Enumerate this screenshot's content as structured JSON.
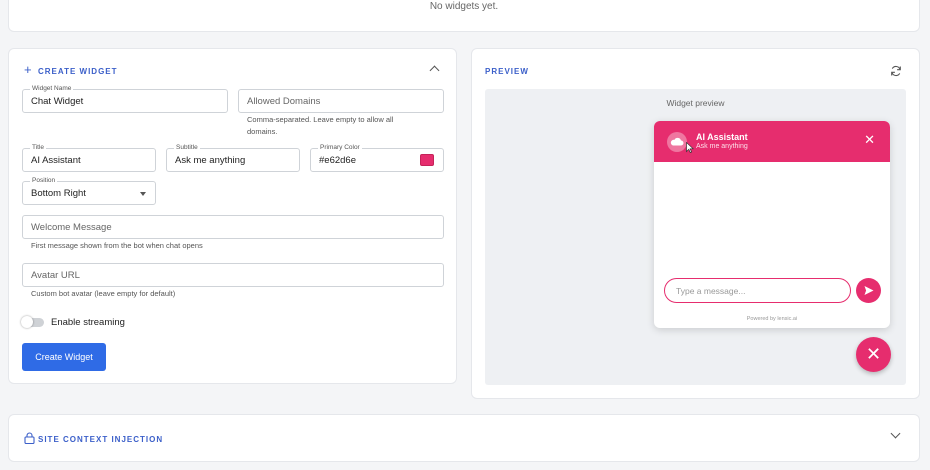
{
  "top": {
    "empty_text": "No widgets yet."
  },
  "create": {
    "title": "CREATE WIDGET",
    "widget_name": {
      "label": "Widget Name",
      "value": "Chat Widget"
    },
    "allowed_domains": {
      "placeholder": "Allowed Domains",
      "help": "Comma-separated. Leave empty to allow all domains."
    },
    "title_field": {
      "label": "Title",
      "value": "AI Assistant"
    },
    "subtitle_field": {
      "label": "Subtitle",
      "value": "Ask me anything"
    },
    "primary_color": {
      "label": "Primary Color",
      "value": "#e62d6e"
    },
    "position": {
      "label": "Position",
      "value": "Bottom Right"
    },
    "welcome": {
      "placeholder": "Welcome Message",
      "help": "First message shown from the bot when chat opens"
    },
    "avatar": {
      "placeholder": "Avatar URL",
      "help": "Custom bot avatar (leave empty for default)"
    },
    "streaming": {
      "label": "Enable streaming",
      "enabled": false
    },
    "submit_label": "Create Widget"
  },
  "preview": {
    "title": "PREVIEW",
    "caption": "Widget preview",
    "chat": {
      "title": "AI Assistant",
      "subtitle": "Ask me anything",
      "input_placeholder": "Type a message...",
      "footer": "Powered by lensic.ai",
      "close_glyph": "✕",
      "fab_glyph": "✕"
    }
  },
  "site_context": {
    "title": "SITE CONTEXT INJECTION"
  },
  "colors": {
    "accent": "#3b5fc9",
    "brand": "#e62d6e",
    "primary_button": "#2f6be6"
  }
}
